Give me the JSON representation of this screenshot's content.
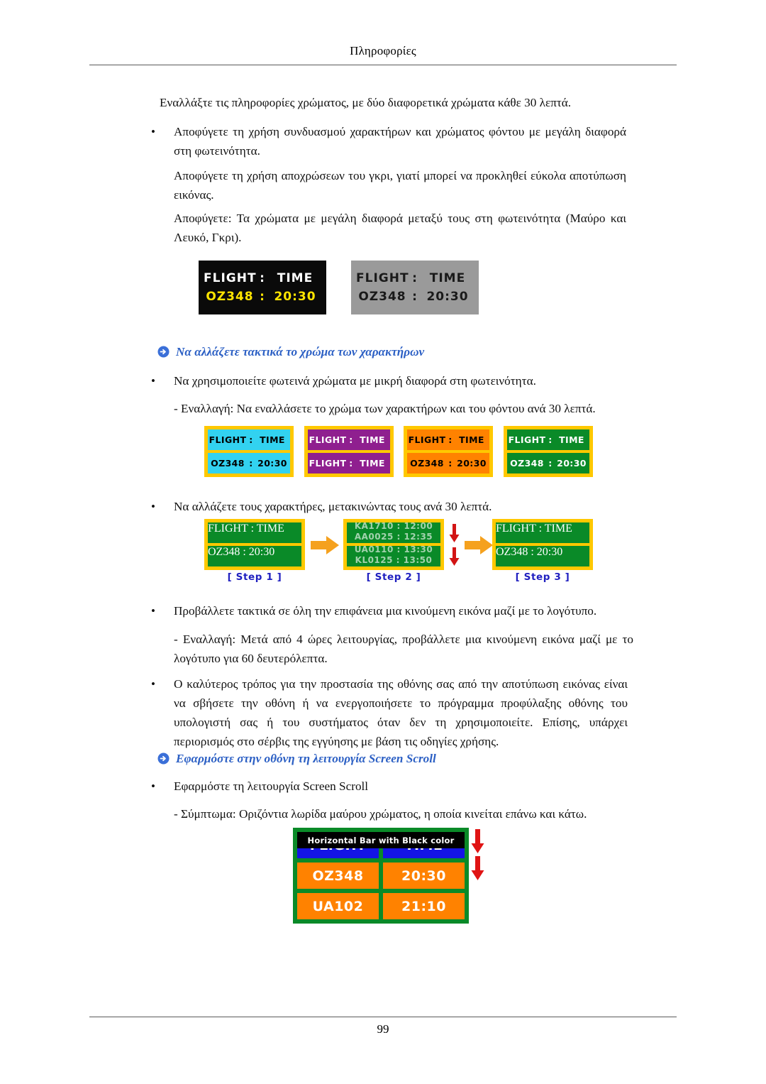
{
  "header": {
    "title": "Πληροφορίες"
  },
  "footer": {
    "page_number": "99"
  },
  "content": {
    "intro": "Εναλλάξτε τις πληροφορίες χρώματος, με δύο διαφορετικά χρώματα κάθε 30 λεπτά.",
    "bullet_1": "Αποφύγετε τη χρήση συνδυασμού χαρακτήρων και χρώματος φόντου με μεγάλη διαφορά στη φωτεινότητα.",
    "para_1": "Αποφύγετε τη χρήση αποχρώσεων του γκρι, γιατί μπορεί να προκληθεί εύκολα αποτύπωση εικόνας.",
    "para_2": "Αποφύγετε: Τα χρώματα με μεγάλη διαφορά μεταξύ τους στη φωτεινότητα (Μαύρο και Λευκό, Γκρι).",
    "heading_1": "Να αλλάζετε τακτικά το χρώμα των χαρακτήρων",
    "bullet_2": "Να χρησιμοποιείτε φωτεινά χρώματα με μικρή διαφορά στη φωτεινότητα.",
    "sub_1": "- Εναλλαγή: Να εναλλάσετε το χρώμα των χαρακτήρων και του φόντου ανά 30 λεπτά.",
    "bullet_3": "Να αλλάζετε τους χαρακτήρες, μετακινώντας τους ανά 30 λεπτά.",
    "bullet_4": "Προβάλλετε τακτικά σε όλη την επιφάνεια μια κινούμενη εικόνα μαζί με το λογότυπο.",
    "sub_2": "- Εναλλαγή: Μετά από 4 ώρες λειτουργίας, προβάλλετε μια κινούμενη εικόνα μαζί με το λογότυπο για 60 δευτερόλεπτα.",
    "bullet_5": "Ο καλύτερος τρόπος για την προστασία της οθόνης σας από την αποτύπωση εικόνας είναι να σβήσετε την οθόνη ή να ενεργοποιήσετε το πρόγραμμα προφύλαξης οθόνης του υπολογιστή σας ή του συστήματος όταν δεν τη χρησιμοποιείτε. Επίσης, υπάρχει περιορισμός στο σέρβις της εγγύησης με βάση τις οδηγίες χρήσης.",
    "heading_2": "Εφαρμόστε στην οθόνη τη λειτουργία Screen Scroll",
    "bullet_6": "Εφαρμόστε τη λειτουργία Screen Scroll",
    "sub_3": "- Σύμπτωμα: Οριζόντια λωρίδα μαύρου χρώματος, η οποία κινείται επάνω και κάτω.",
    "bullet_char": "•"
  },
  "figure_contrast": {
    "panels": [
      {
        "name": "black-display",
        "background": "#0a0a0a",
        "row1": {
          "label": "FLIGHT",
          "sep": ":",
          "value": "TIME",
          "color": "#ffffff"
        },
        "row2": {
          "label": "OZ348",
          "sep": ":",
          "value": "20:30",
          "color": "#ffe400"
        }
      },
      {
        "name": "grey-display",
        "background": "#9a9a9a",
        "row1": {
          "label": "FLIGHT",
          "sep": ":",
          "value": "TIME",
          "color": "#1a1a1a"
        },
        "row2": {
          "label": "OZ348",
          "sep": ":",
          "value": "20:30",
          "color": "#1a1a1a"
        }
      }
    ]
  },
  "figure_colors": {
    "border_color": "#ffc800",
    "panels": [
      {
        "name": "cyan-panel",
        "background": "#32d2f0",
        "text_color": "#000000",
        "row1": {
          "label": "FLIGHT",
          "sep": ":",
          "value": "TIME"
        },
        "row2": {
          "label": "OZ348",
          "sep": ":",
          "value": "20:30"
        }
      },
      {
        "name": "purple-panel",
        "background": "#8f1f8f",
        "text_color": "#ffffff",
        "row1": {
          "label": "FLIGHT",
          "sep": ":",
          "value": "TIME"
        },
        "row2": {
          "label": "FLIGHT",
          "sep": ":",
          "value": "TIME"
        }
      },
      {
        "name": "orange-panel",
        "background": "#ff8200",
        "text_color": "#000000",
        "row1": {
          "label": "FLIGHT",
          "sep": ":",
          "value": "TIME"
        },
        "row2": {
          "label": "OZ348",
          "sep": ":",
          "value": "20:30"
        }
      },
      {
        "name": "green-panel",
        "background": "#0a8a28",
        "text_color": "#ffffff",
        "row1": {
          "label": "FLIGHT",
          "sep": ":",
          "value": "TIME"
        },
        "row2": {
          "label": "OZ348",
          "sep": ":",
          "value": "20:30"
        }
      }
    ]
  },
  "figure_steps": {
    "label_color": "#2020c0",
    "border_color": "#ffc800",
    "screen_color": "#0a8a28",
    "steps": [
      {
        "label": "[ Step 1 ]",
        "row1": {
          "label": "FLIGHT",
          "sep": ":",
          "value": "TIME"
        },
        "row2": {
          "label": "OZ348",
          "sep": ":",
          "value": "20:30"
        }
      },
      {
        "label": "[ Step 2 ]",
        "scroll_lines": [
          "KA1710 : 12:00",
          "AA0025 : 12:35",
          "UA0110 : 13:30",
          "KL0125 : 13:50"
        ]
      },
      {
        "label": "[ Step 3 ]",
        "row1": {
          "label": "FLIGHT",
          "sep": ":",
          "value": "TIME"
        },
        "row2": {
          "label": "OZ348",
          "sep": ":",
          "value": "20:30"
        }
      }
    ]
  },
  "figure_scroll": {
    "bar_caption": "Horizontal Bar with Black color",
    "board_color": "#0a8a28",
    "header_color": "#1414e6",
    "cell_color": "#ff8200",
    "arrow_color": "#e01414",
    "rows": [
      {
        "left": "FLIGHT",
        "right": "TIME"
      },
      {
        "left": "OZ348",
        "right": "20:30"
      },
      {
        "left": "UA102",
        "right": "21:10"
      }
    ]
  }
}
